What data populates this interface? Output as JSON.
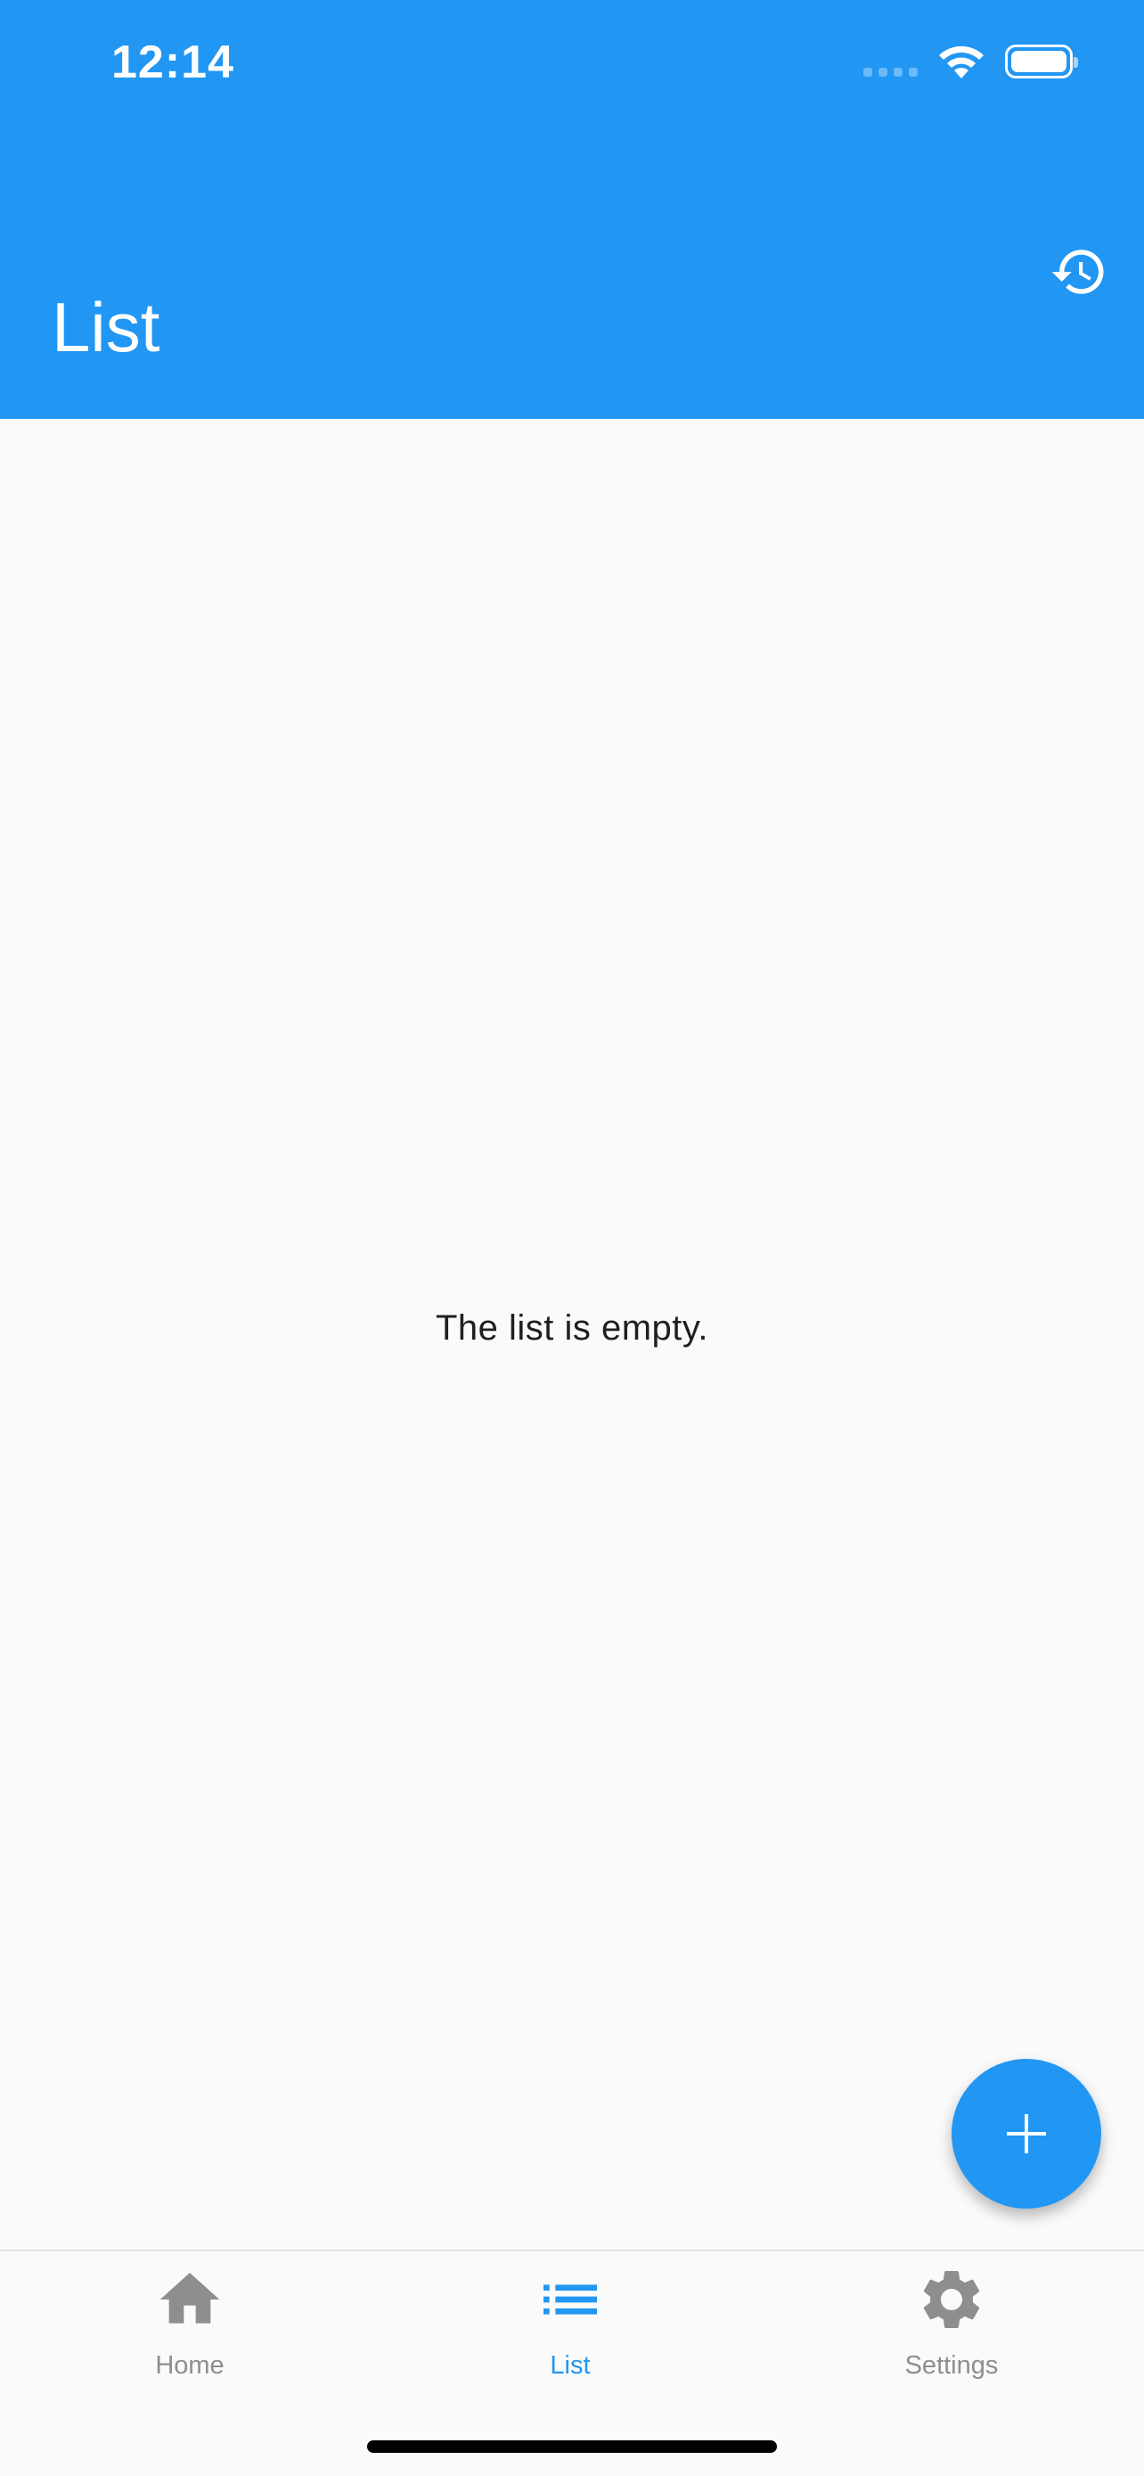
{
  "status_bar": {
    "time": "12:14"
  },
  "app_bar": {
    "title": "List",
    "action_icon": "history-icon"
  },
  "body": {
    "empty_message": "The list is empty."
  },
  "fab": {
    "icon": "add-icon"
  },
  "bottom_nav": {
    "items": [
      {
        "label": "Home",
        "icon": "home-icon",
        "active": false
      },
      {
        "label": "List",
        "icon": "list-icon",
        "active": true
      },
      {
        "label": "Settings",
        "icon": "settings-icon",
        "active": false
      }
    ]
  },
  "colors": {
    "primary": "#2196f3",
    "inactive": "#8e8e8e",
    "background": "#fafafa"
  }
}
